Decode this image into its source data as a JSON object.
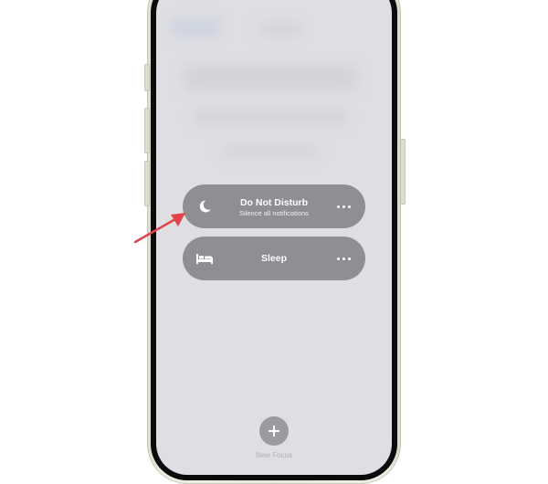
{
  "focus_modes": [
    {
      "title": "Do Not Disturb",
      "subtitle": "Silence all notifications",
      "icon": "moon-icon",
      "more": "more-options-icon"
    },
    {
      "title": "Sleep",
      "subtitle": "",
      "icon": "bed-icon",
      "more": "more-options-icon"
    }
  ],
  "new_focus": {
    "label": "New Focus",
    "icon": "plus-icon"
  },
  "annotation": {
    "color": "#e0454b"
  },
  "colors": {
    "card": "#8e8e93",
    "screen": "#dfdfe3"
  }
}
